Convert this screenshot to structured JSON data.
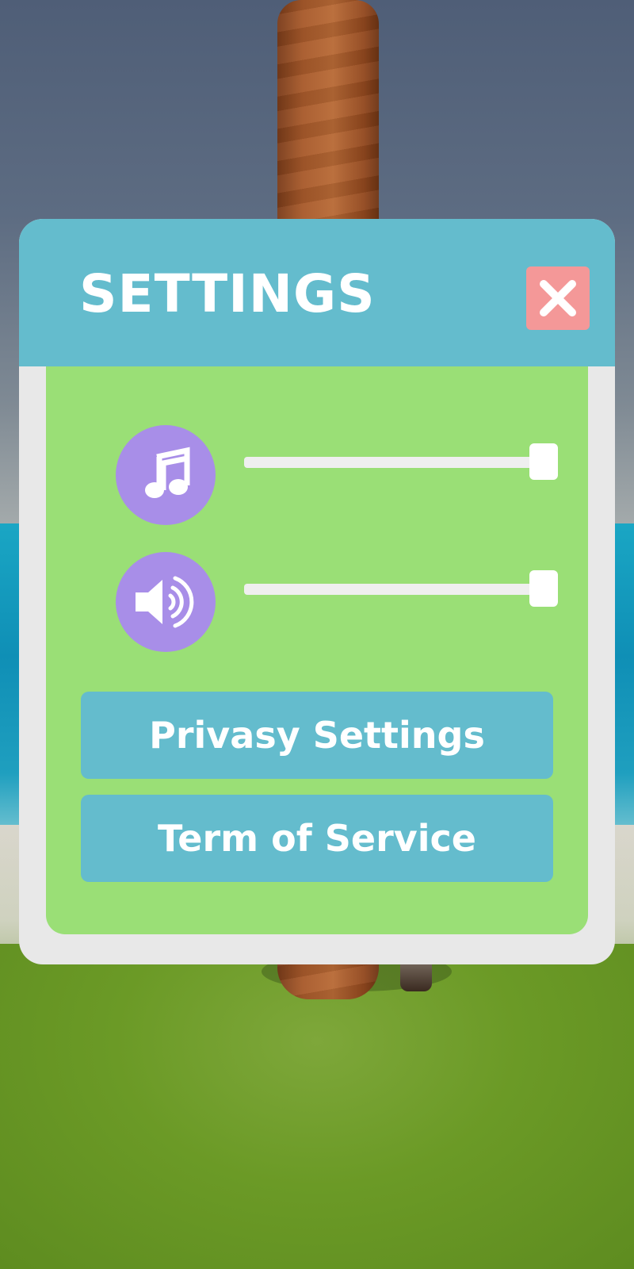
{
  "settings": {
    "title": "SETTINGS",
    "music_volume": 1.0,
    "sound_volume": 1.0,
    "privacy_button_label": "Privasy Settings",
    "tos_button_label": "Term of Service"
  },
  "icons": {
    "close": "close-icon",
    "music": "music-note-icon",
    "sound": "speaker-icon"
  },
  "colors": {
    "header": "#64bccd",
    "body": "#9adf76",
    "close_button": "#f49898",
    "icon_circle": "#a88ee8"
  }
}
